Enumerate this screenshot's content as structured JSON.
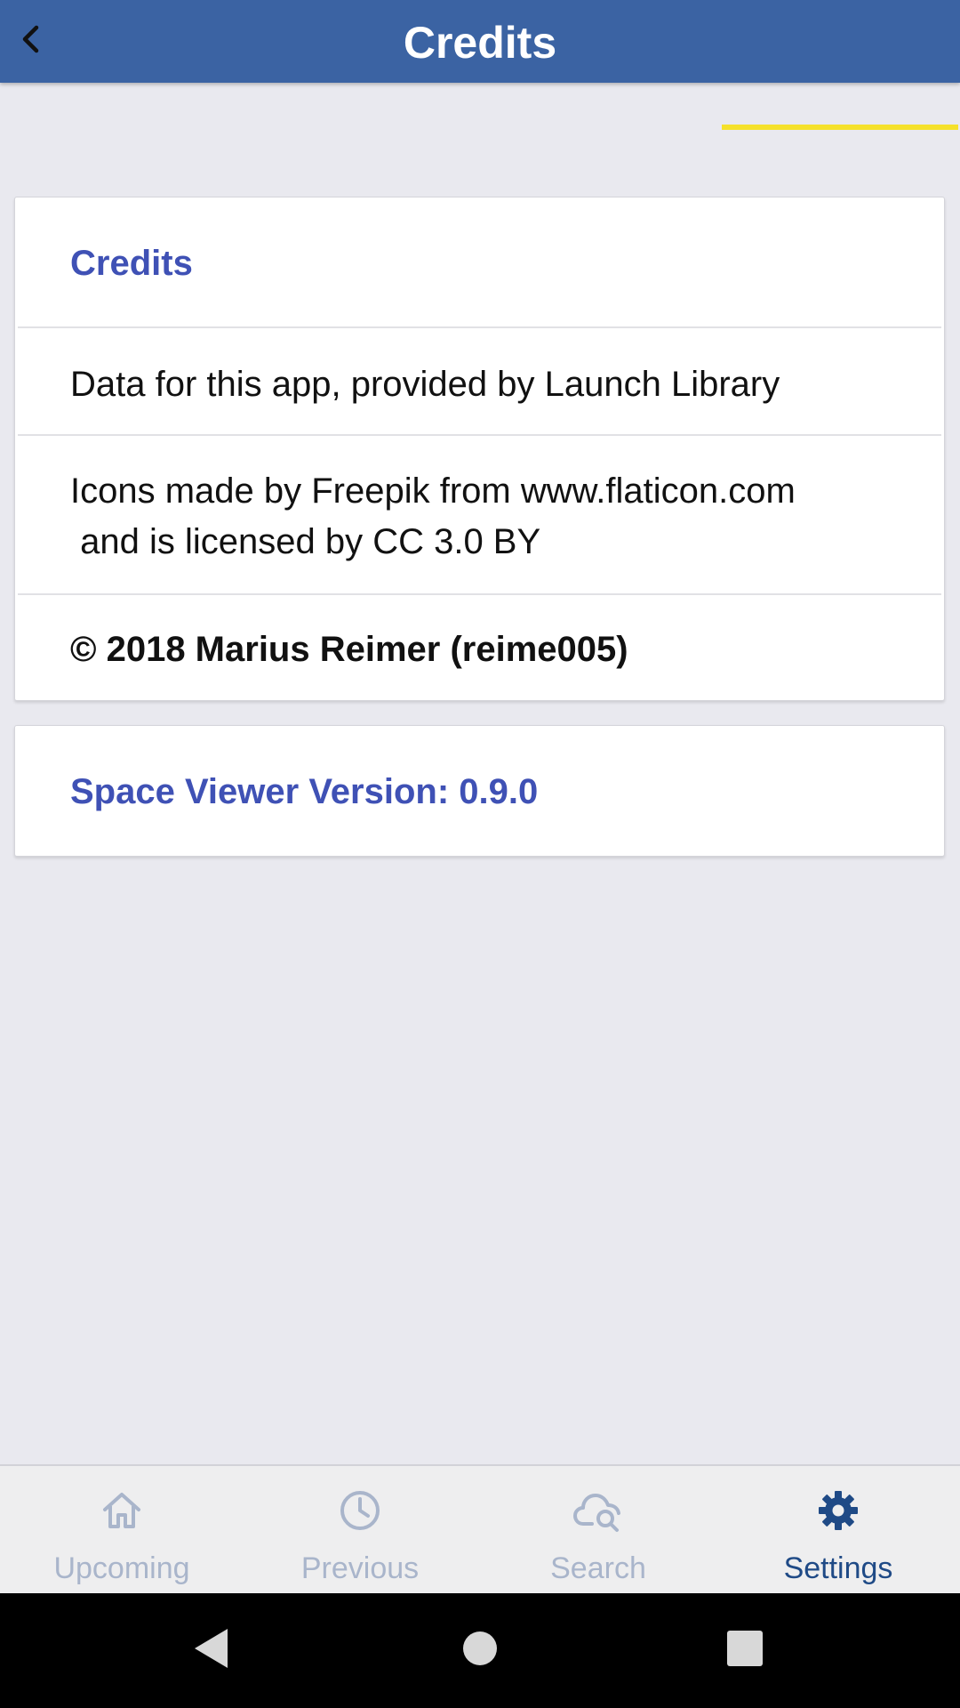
{
  "appbar": {
    "title": "Credits",
    "back_icon": "chevron-left-icon"
  },
  "credits_card": {
    "title": "Credits",
    "launch_library_text": "Data for this app, provided by Launch Library",
    "icons_line1": "Icons made by Freepik from www.flaticon.com",
    "icons_line2": " and is licensed by CC 3.0 BY",
    "copyright": "© 2018 Marius Reimer (reime005)"
  },
  "version_card": {
    "text": "Space Viewer Version: 0.9.0"
  },
  "bottom_nav": {
    "items": [
      {
        "label": "Upcoming",
        "icon": "home-icon"
      },
      {
        "label": "Previous",
        "icon": "clock-icon"
      },
      {
        "label": "Search",
        "icon": "cloud-search-icon"
      },
      {
        "label": "Settings",
        "icon": "gear-icon"
      }
    ],
    "active": "Settings"
  },
  "colors": {
    "appbar": "#3b63a3",
    "accent_text": "#3f51b5",
    "active_nav": "#1f4a86",
    "inactive_nav": "#a9b5cb",
    "active_indicator": "#f5e12b",
    "background": "#e9e9ef"
  },
  "system_nav": {
    "back_icon": "triangle-back-icon",
    "home_icon": "circle-home-icon",
    "recents_icon": "square-recents-icon"
  }
}
